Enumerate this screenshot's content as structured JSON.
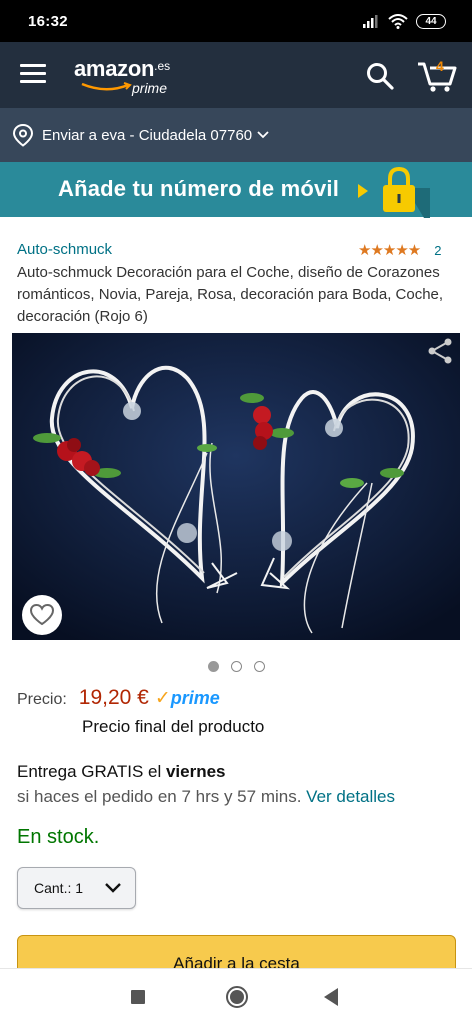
{
  "status_bar": {
    "time": "16:32",
    "battery": "44"
  },
  "header": {
    "logo_word": "amazon",
    "logo_domain": ".es",
    "logo_sub": "prime",
    "cart_count": "4"
  },
  "delivery_bar": {
    "text": "Enviar a eva - Ciudadela 07760"
  },
  "promo": {
    "text": "Añade tu número de móvil"
  },
  "product": {
    "brand": "Auto-schmuck",
    "stars": "★★★★★",
    "rating_count": "2",
    "title": "Auto-schmuck Decoración para el Coche, diseño de Corazones románticos, Novia, Pareja, Rosa, decoración para Boda, Coche, decoración (Rojo 6)",
    "image_count": 3,
    "image_active_index": 1,
    "rating_value": 4.5
  },
  "price": {
    "label": "Precio:",
    "value": "19,20 €",
    "prime_check": "✓",
    "prime_label": "prime",
    "final_note": "Precio final del producto"
  },
  "delivery": {
    "prefix": "Entrega GRATIS el ",
    "day": "viernes",
    "sub_text": "si haces el pedido en 7 hrs y 57 mins. ",
    "details_link": "Ver detalles"
  },
  "stock": {
    "text": "En stock."
  },
  "quantity": {
    "label": "Cant.: 1"
  },
  "buttons": {
    "add_to_cart": "Añadir a la cesta"
  },
  "colors": {
    "nav_dark": "#232f3e",
    "deliver_bar": "#37475a",
    "promo_teal": "#2a8a9a",
    "link": "#007185",
    "price": "#b12704",
    "stock": "#007600",
    "add_to_cart": "#f7ca4d",
    "star": "#de7921"
  }
}
